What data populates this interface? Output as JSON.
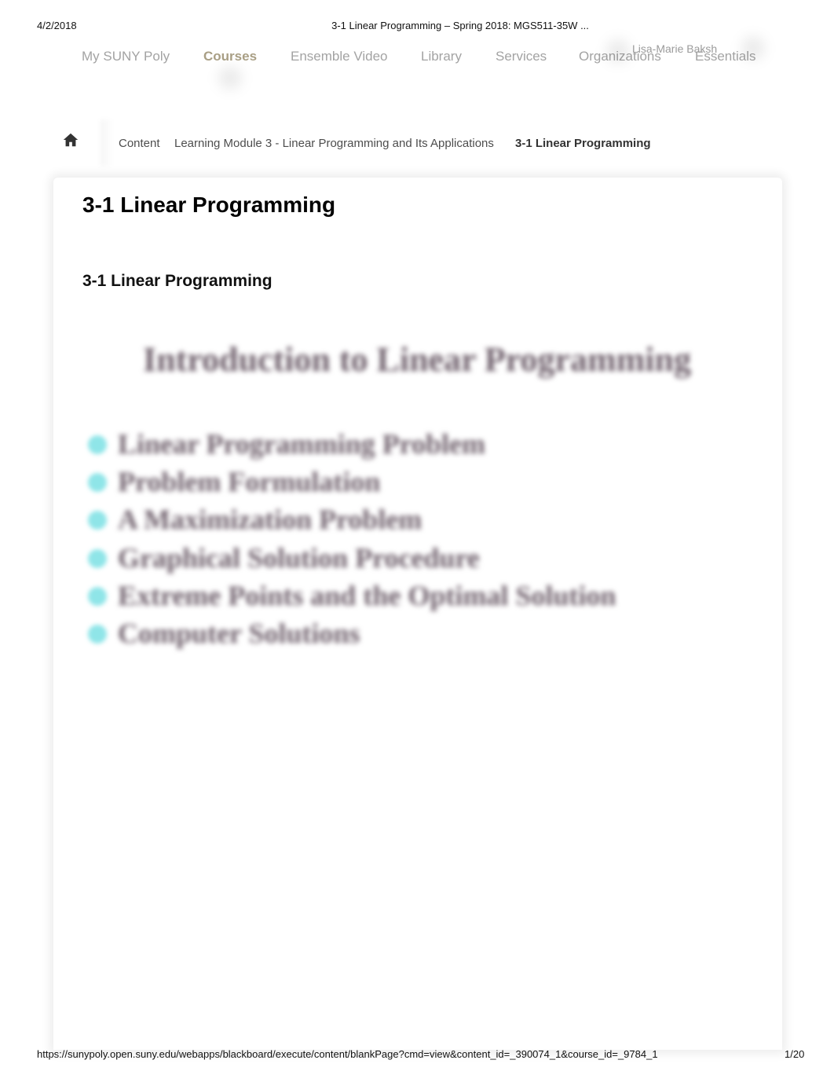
{
  "print": {
    "date": "4/2/2018",
    "title": "3-1 Linear Programming – Spring 2018: MGS511-35W ...",
    "url": "https://sunypoly.open.suny.edu/webapps/blackboard/execute/content/blankPage?cmd=view&content_id=_390074_1&course_id=_9784_1",
    "page": "1/20"
  },
  "topnav": {
    "items": [
      {
        "label": "My SUNY Poly",
        "active": false
      },
      {
        "label": "Courses",
        "active": true
      },
      {
        "label": "Ensemble Video",
        "active": false
      },
      {
        "label": "Library",
        "active": false
      },
      {
        "label": "Services",
        "active": false
      },
      {
        "label": "Organizations",
        "active": false
      },
      {
        "label": "Essentials",
        "active": false
      }
    ],
    "user_name": "Lisa-Marie Baksh",
    "accent_color": "#a99f85"
  },
  "breadcrumb": {
    "home_icon": "home-icon",
    "items": [
      {
        "label": "Content"
      },
      {
        "label": "Learning Module 3 - Linear Programming and Its Applications"
      },
      {
        "label": "3-1 Linear Programming",
        "current": true
      }
    ]
  },
  "content": {
    "page_title": "3-1 Linear Programming",
    "item_title": "3-1 Linear Programming",
    "slide": {
      "title": "Introduction to Linear Programming",
      "bullet_color": "#8fe5e8",
      "bullets": [
        "Linear Programming Problem",
        "Problem Formulation",
        "A Maximization Problem",
        "Graphical Solution Procedure",
        "Extreme Points and the Optimal Solution",
        "Computer Solutions"
      ]
    }
  }
}
